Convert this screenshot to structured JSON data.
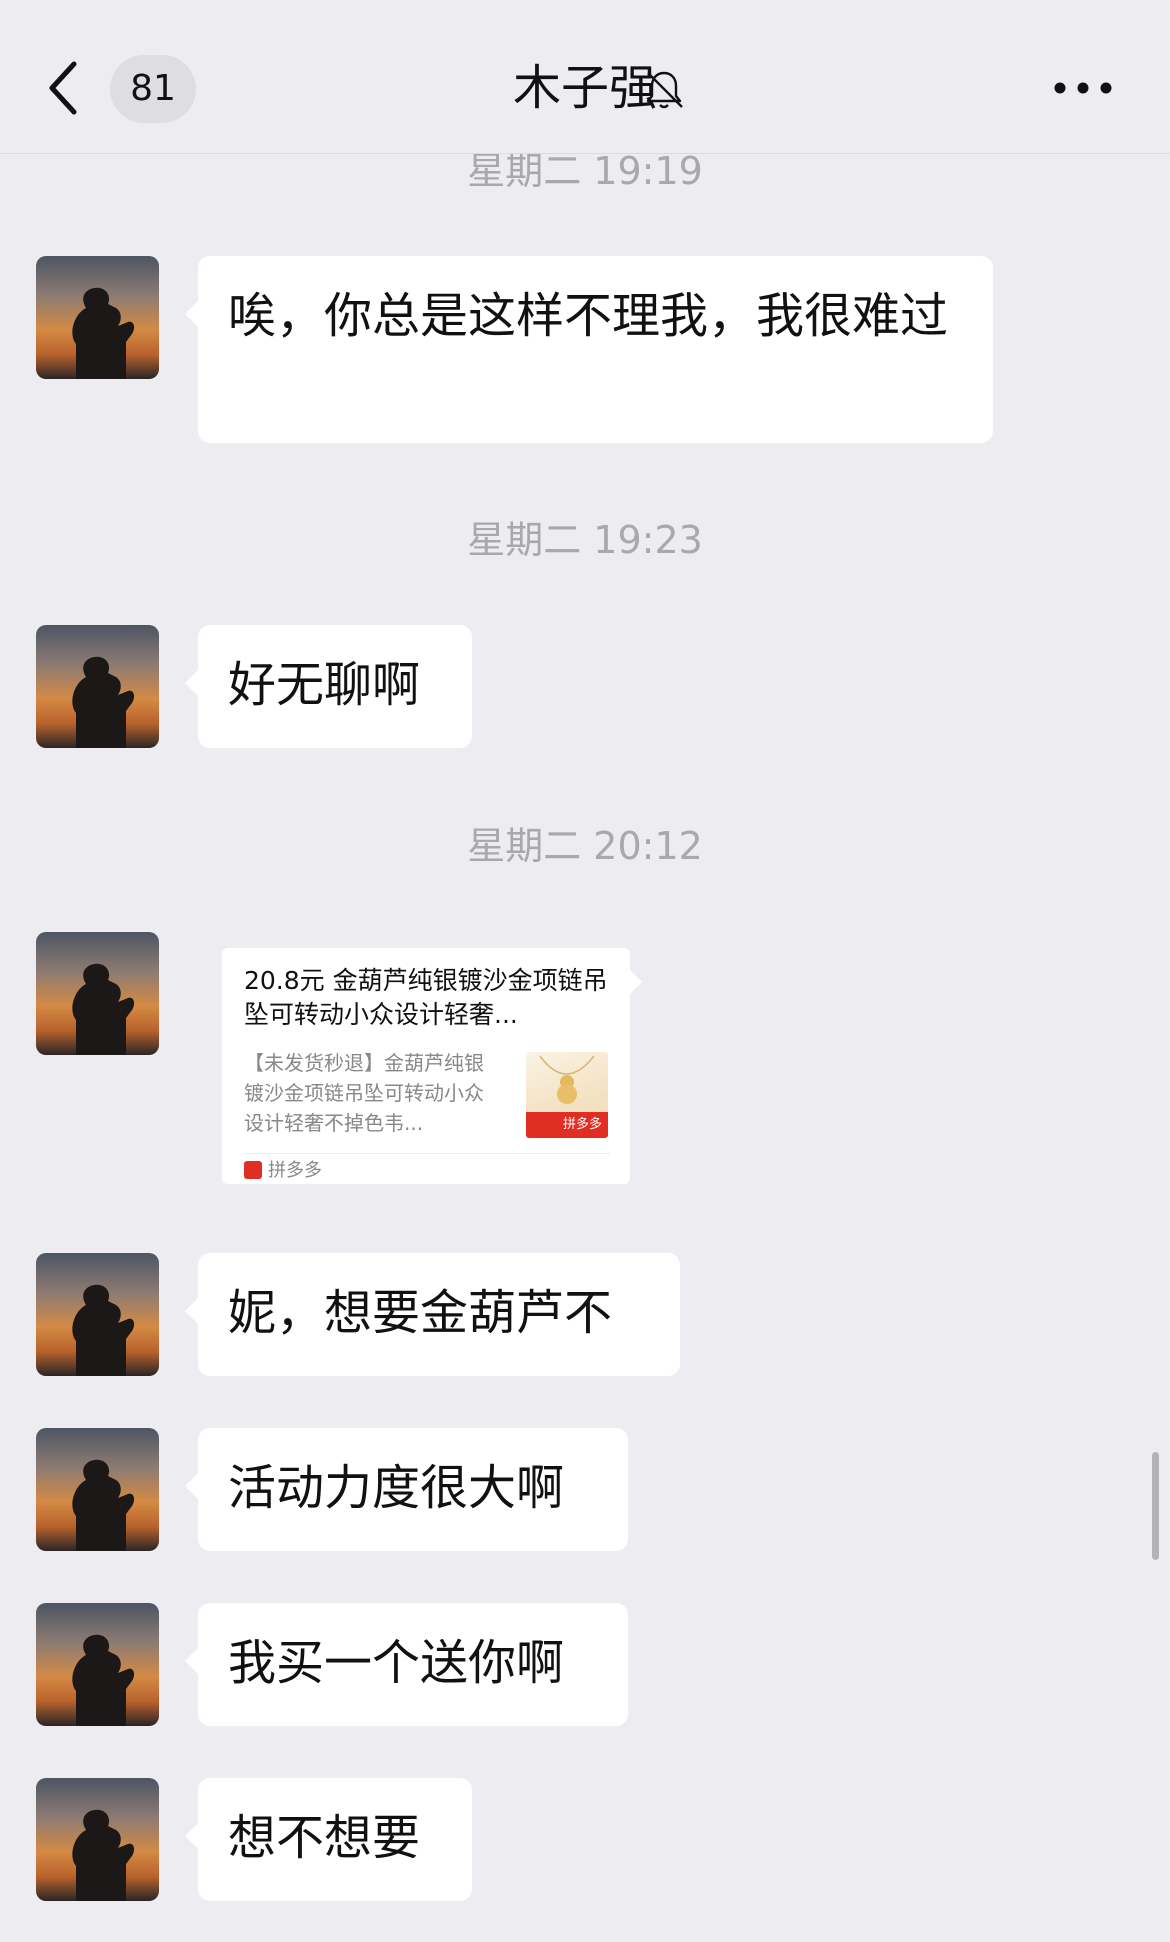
{
  "header": {
    "unread_count": "81",
    "title": "木子强"
  },
  "icons": {
    "back": "chevron-left-icon",
    "mute": "bell-slash-icon",
    "more": "ellipsis-icon"
  },
  "messages": [
    {
      "time": "星期二 19:19",
      "text": "唉，你总是这样不理我，我很难过"
    },
    {
      "time": "星期二 19:23",
      "text": "好无聊啊"
    },
    {
      "time": "星期二 20:12"
    },
    {
      "text": "妮，想要金葫芦不"
    },
    {
      "text": "活动力度很大啊"
    },
    {
      "text": "我买一个送你啊"
    },
    {
      "text": "想不想要"
    }
  ],
  "link_card": {
    "title": "20.8元 金葫芦纯银镀沙金项链吊坠可转动小众设计轻奢...",
    "description": "【未发货秒退】金葫芦纯银镀沙金项链吊坠可转动小众设计轻奢不掉色韦...",
    "thumb_label": "拼多多",
    "source": "拼多多"
  },
  "colors": {
    "background": "#edecf0",
    "bubble": "#ffffff",
    "timestamp": "#a9a8ad",
    "brand_red": "#e02e24"
  }
}
